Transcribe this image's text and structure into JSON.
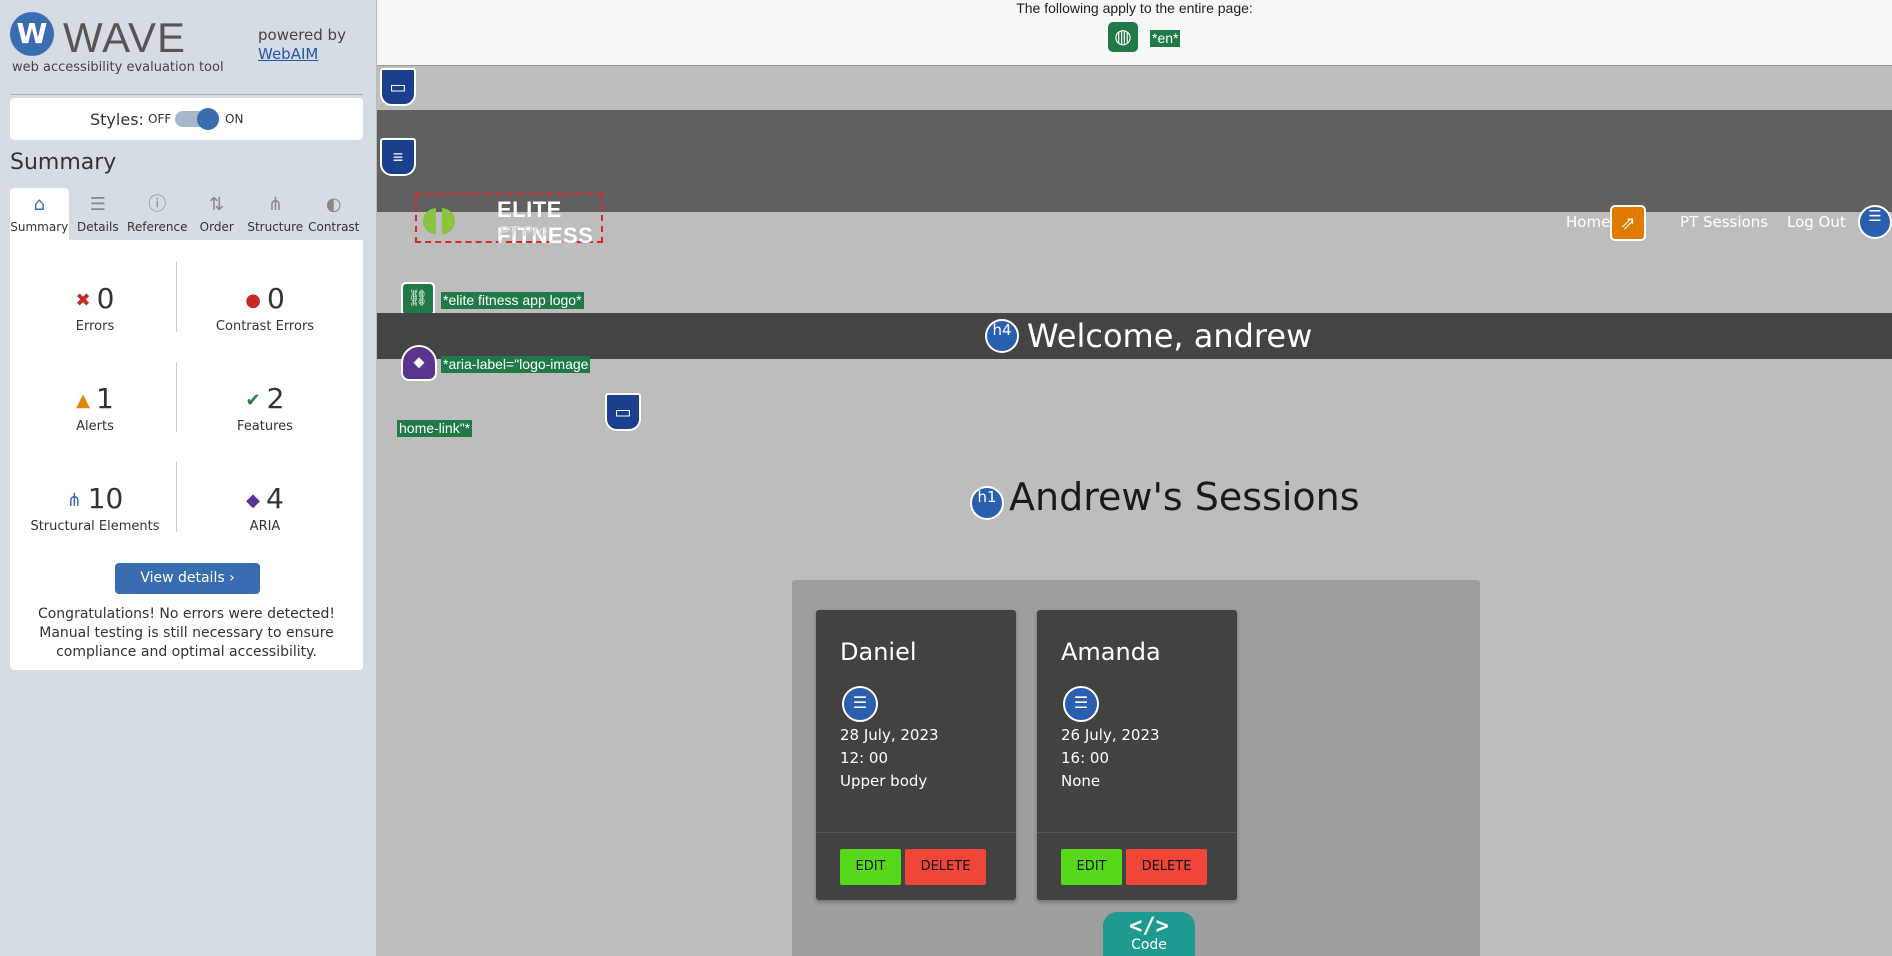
{
  "sidebar": {
    "logo_letter": "W",
    "brand": "WAVE",
    "brand_sub": "web accessibility evaluation tool",
    "powered_by": "powered by",
    "powered_link": "WebAIM",
    "styles_label": "Styles:",
    "styles_off": "OFF",
    "styles_on": "ON",
    "styles_state": "on",
    "summary_title": "Summary",
    "tabs": [
      {
        "label": "Summary",
        "icon": "home-icon",
        "glyph": "⌂"
      },
      {
        "label": "Details",
        "icon": "list-icon",
        "glyph": "☰"
      },
      {
        "label": "Reference",
        "icon": "info-icon",
        "glyph": "ⓘ"
      },
      {
        "label": "Order",
        "icon": "order-icon",
        "glyph": "⇅"
      },
      {
        "label": "Structure",
        "icon": "hierarchy-icon",
        "glyph": "⋔"
      },
      {
        "label": "Contrast",
        "icon": "contrast-icon",
        "glyph": "◐"
      }
    ],
    "stats": {
      "errors": {
        "count": "0",
        "label": "Errors",
        "glyph": "✖",
        "color": "#c62828"
      },
      "contrast_errors": {
        "count": "0",
        "label": "Contrast Errors",
        "glyph": "●",
        "color": "#c62828"
      },
      "alerts": {
        "count": "1",
        "label": "Alerts",
        "glyph": "▲",
        "color": "#e08a00"
      },
      "features": {
        "count": "2",
        "label": "Features",
        "glyph": "✔",
        "color": "#2e7d4f"
      },
      "structural": {
        "count": "10",
        "label": "Structural Elements",
        "glyph": "⋔",
        "color": "#3a6db0"
      },
      "aria": {
        "count": "4",
        "label": "ARIA",
        "glyph": "◆",
        "color": "#5a3590"
      }
    },
    "view_details": "View details ›",
    "congrats": "Congratulations! No errors were detected! Manual testing is still necessary to ensure compliance and optimal accessibility."
  },
  "page": {
    "top_note": "The following apply to the entire page:",
    "lang_tag": "*en*",
    "logo_title": "ELITE FITNESS",
    "logo_sub": "PT Pro",
    "nav": {
      "home": "Home",
      "sessions": "PT Sessions",
      "logout": "Log Out"
    },
    "tag_logo_alt": "*elite fitness app logo*",
    "tag_aria_label": "*aria-label=\"logo-image",
    "tag_home_link": "home-link\"*",
    "h4_badge": "h4",
    "welcome": "Welcome, andrew",
    "h1_badge": "h1",
    "sessions_title": "Andrew's Sessions",
    "sessions": [
      {
        "name": "Daniel",
        "date": "28 July, 2023",
        "time": "12: 00",
        "focus": "Upper body"
      },
      {
        "name": "Amanda",
        "date": "26 July, 2023",
        "time": "16: 00",
        "focus": "None"
      }
    ],
    "edit_label": "EDIT",
    "delete_label": "DELETE",
    "code_glyph": "</>",
    "code_label": "Code"
  }
}
